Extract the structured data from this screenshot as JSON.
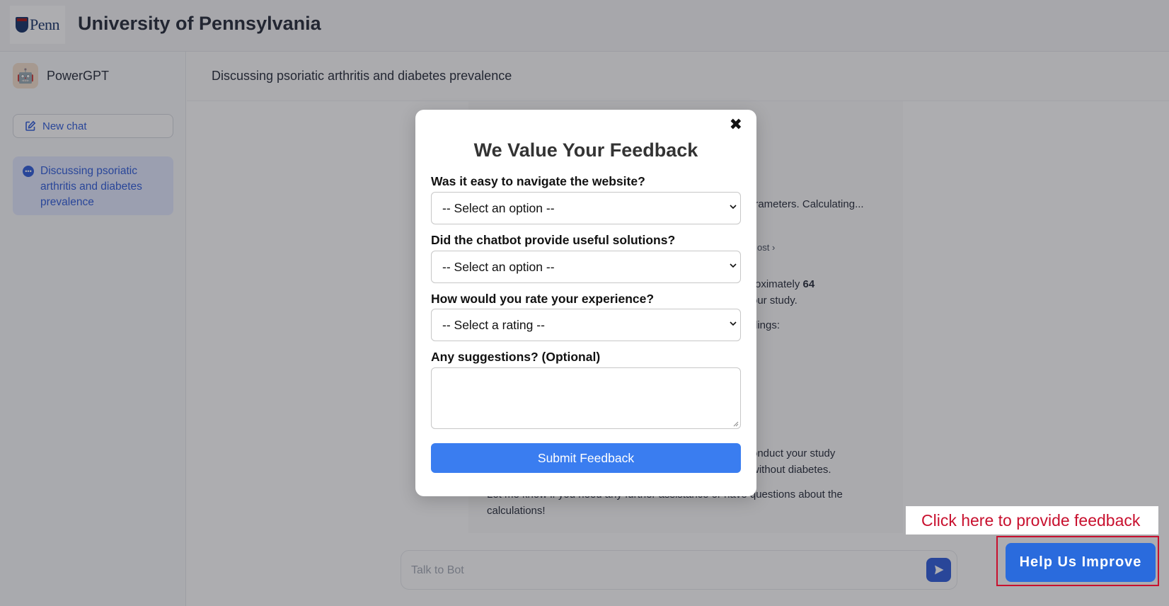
{
  "header": {
    "title": "University of Pennsylvania",
    "logo_text": "Penn"
  },
  "sidebar": {
    "brand_name": "PowerGPT",
    "new_chat_label": "New chat",
    "conversations": [
      {
        "label": "Discussing psoriatic arthritis and diabetes prevalence"
      }
    ]
  },
  "main": {
    "title": "Discussing psoriatic arthritis and diabetes prevalence",
    "chat_fragments": {
      "line1": "arameters. Calculating...",
      "link1": "ost",
      "line2a": "roximately ",
      "line2b": "64",
      "line3": "our study.",
      "line4": "dings:",
      "line5": "onduct your study",
      "line6": "without diabetes.",
      "line7": "Let me know if you need any further assistance or have questions about the",
      "line8": "calculations!"
    },
    "input_placeholder": "Talk to Bot"
  },
  "modal": {
    "title": "We Value Your Feedback",
    "close_glyph": "✖",
    "q1": {
      "label": "Was it easy to navigate the website?",
      "selected": "-- Select an option --"
    },
    "q2": {
      "label": "Did the chatbot provide useful solutions?",
      "selected": "-- Select an option --"
    },
    "q3": {
      "label": "How would you rate your experience?",
      "selected": "-- Select a rating --"
    },
    "q4": {
      "label": "Any suggestions? (Optional)",
      "value": ""
    },
    "submit_label": "Submit Feedback"
  },
  "feedback": {
    "callout_text": "Click here to provide feedback",
    "button_label": "Help Us Improve"
  },
  "colors": {
    "accent": "#1d4ed8",
    "submit": "#3a7df0",
    "help_button": "#2a6bdd",
    "callout_red": "#c8102e"
  }
}
